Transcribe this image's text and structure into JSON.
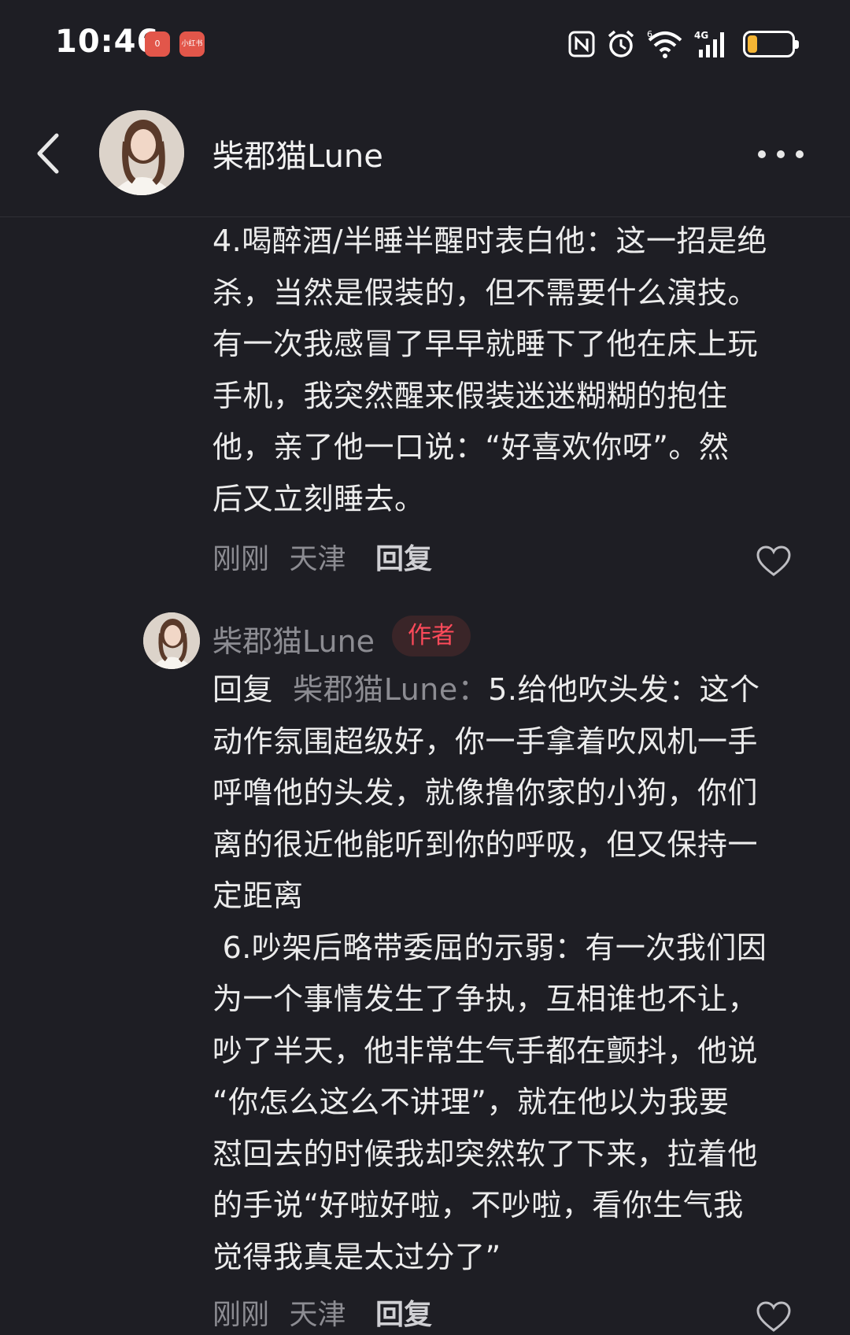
{
  "status_bar": {
    "time": "10:46",
    "app_badge_1": "0",
    "app_badge_2": "小红书",
    "network": "4G",
    "wifi_tag": "6"
  },
  "header": {
    "username": "柴郡猫Lune"
  },
  "comment_main": {
    "text": "4.喝醉酒/半睡半醒时表白他：这一招是绝\n杀，当然是假装的，但不需要什么演技。\n有一次我感冒了早早就睡下了他在床上玩\n手机，我突然醒来假装迷迷糊糊的抱住\n他，亲了他一口说：“好喜欢你呀”。然\n后又立刻睡去。",
    "time": "刚刚",
    "location": "天津",
    "reply_label": "回复"
  },
  "reply": {
    "author": "柴郡猫Lune",
    "author_badge": "作者",
    "prefix": "回复",
    "target": "柴郡猫Lune：",
    "text_first": "5.给他吹头发：这个",
    "text_rest": "动作氛围超级好，你一手拿着吹风机一手\n呼噜他的头发，就像撸你家的小狗，你们\n离的很近他能听到你的呼吸，但又保持一\n定距离\n 6.吵架后略带委屈的示弱：有一次我们因\n为一个事情发生了争执，互相谁也不让，\n吵了半天，他非常生气手都在颤抖，他说\n“你怎么这么不讲理”，就在他以为我要\n怼回去的时候我却突然软了下来，拉着他\n的手说“好啦好啦，不吵啦，看你生气我\n觉得我真是太过分了”",
    "time": "刚刚",
    "location": "天津",
    "reply_label": "回复"
  },
  "colors": {
    "background": "#1e1e24",
    "muted_text": "#8c8c92",
    "author_badge": "#ff4a5a",
    "battery": "#f5b534"
  }
}
